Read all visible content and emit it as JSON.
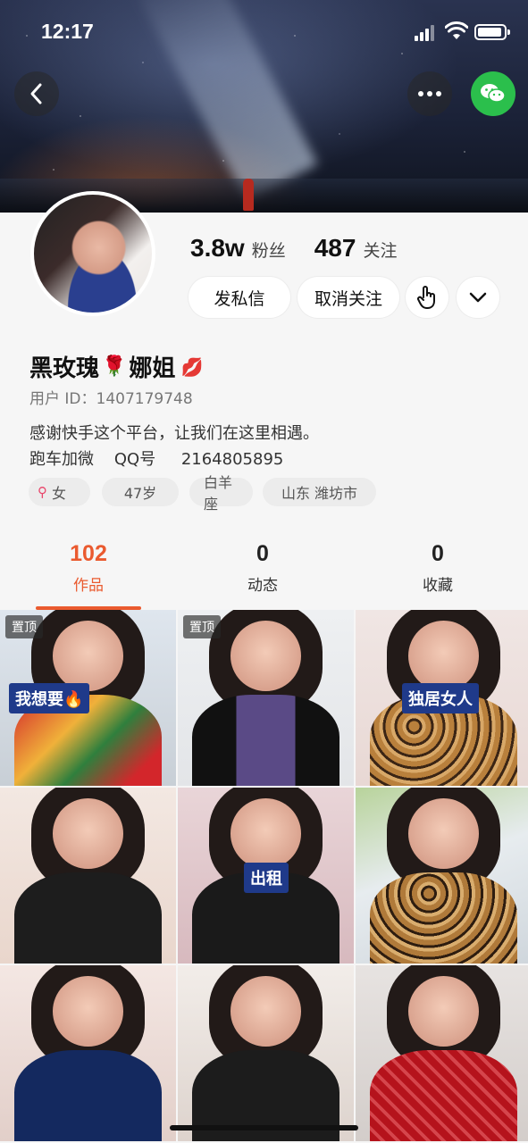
{
  "status_bar": {
    "time": "12:17"
  },
  "header": {
    "back_icon": "chevron-left-icon",
    "more_icon": "more-horizontal-icon",
    "share_icon": "wechat-icon",
    "accent_share": "#2bbf4c"
  },
  "profile": {
    "followers_count": "3.8w",
    "followers_label": "粉丝",
    "following_count": "487",
    "following_label": "关注",
    "message_button": "发私信",
    "unfollow_button": "取消关注",
    "gesture_icon": "tap-hand-icon",
    "expand_icon": "chevron-down-icon",
    "name_part1": "黑玫瑰",
    "name_emoji1": "🌹",
    "name_part2": "娜姐",
    "name_emoji2": "💋",
    "user_id": "用户 ID：1407179748",
    "bio_line1": "感谢快手这个平台，让我们在这里相遇。",
    "bio_line2": "跑车加微    QQ号     2164805895",
    "tags": {
      "gender_symbol": "⚲",
      "gender": "女",
      "age": "47岁",
      "zodiac": "白羊座",
      "location": "山东 潍坊市"
    }
  },
  "tabs": [
    {
      "count": "102",
      "label": "作品",
      "active": true
    },
    {
      "count": "0",
      "label": "动态",
      "active": false
    },
    {
      "count": "0",
      "label": "收藏",
      "active": false
    }
  ],
  "accent_color": "#ea5a2f",
  "grid": [
    {
      "pinned": "置顶",
      "caption": "我想要🔥"
    },
    {
      "pinned": "置顶",
      "caption": ""
    },
    {
      "pinned": "",
      "caption": "独居女人"
    },
    {
      "pinned": "",
      "caption": ""
    },
    {
      "pinned": "",
      "caption": "出租"
    },
    {
      "pinned": "",
      "caption": ""
    },
    {
      "pinned": "",
      "caption": ""
    },
    {
      "pinned": "",
      "caption": ""
    },
    {
      "pinned": "",
      "caption": ""
    }
  ]
}
